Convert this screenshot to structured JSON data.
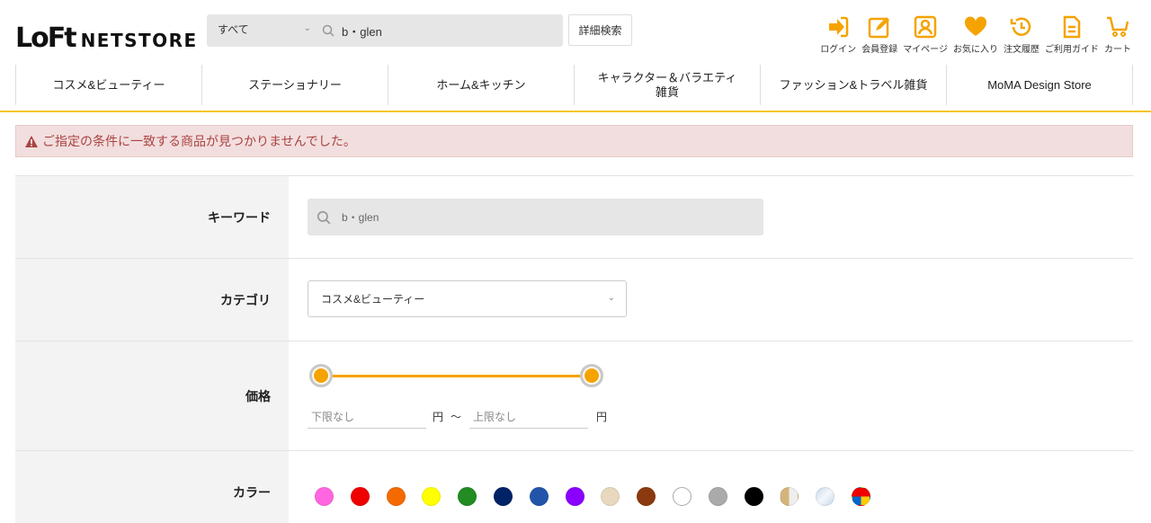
{
  "logo": {
    "mark": "LoFt",
    "text": "NETSTORE"
  },
  "search": {
    "category": "すべて",
    "value": "b・glen",
    "detail_label": "詳細検索"
  },
  "header_links": [
    {
      "label": "ログイン",
      "icon": "login-icon"
    },
    {
      "label": "会員登録",
      "icon": "register-icon"
    },
    {
      "label": "マイページ",
      "icon": "mypage-icon"
    },
    {
      "label": "お気に入り",
      "icon": "heart-icon"
    },
    {
      "label": "注文履歴",
      "icon": "history-icon"
    },
    {
      "label": "ご利用ガイド",
      "icon": "guide-icon"
    },
    {
      "label": "カート",
      "icon": "cart-icon"
    }
  ],
  "nav": [
    {
      "label": "コスメ&ビューティー"
    },
    {
      "label": "ステーショナリー"
    },
    {
      "label": "ホーム&キッチン"
    },
    {
      "label": "キャラクター＆バラエティ雑貨"
    },
    {
      "label": "ファッション&トラベル雑貨"
    },
    {
      "label": "MoMA Design Store"
    }
  ],
  "alert": {
    "message": "ご指定の条件に一致する商品が見つかりませんでした。"
  },
  "form": {
    "keyword": {
      "label": "キーワード",
      "value": "b・glen"
    },
    "category": {
      "label": "カテゴリ",
      "value": "コスメ&ビューティー"
    },
    "price": {
      "label": "価格",
      "min_placeholder": "下限なし",
      "max_placeholder": "上限なし",
      "unit": "円",
      "separator": "～"
    },
    "color": {
      "label": "カラー"
    }
  },
  "colors": {
    "accent": "#f5a300",
    "nav_line": "#f5c518",
    "alert_bg": "#f2dede",
    "alert_text": "#a94442",
    "swatches": [
      {
        "name": "pink",
        "color": "#ff66e0"
      },
      {
        "name": "red",
        "color": "#ee0000"
      },
      {
        "name": "orange",
        "color": "#f56a00"
      },
      {
        "name": "yellow",
        "color": "#ffff00"
      },
      {
        "name": "green",
        "color": "#228b22"
      },
      {
        "name": "navy",
        "color": "#002266"
      },
      {
        "name": "blue",
        "color": "#2255aa"
      },
      {
        "name": "purple",
        "color": "#8a00ff"
      },
      {
        "name": "beige",
        "color": "#e8d8be"
      },
      {
        "name": "brown",
        "color": "#8b3a0f"
      },
      {
        "name": "white",
        "color": "#ffffff"
      },
      {
        "name": "gray",
        "color": "#aaaaaa"
      },
      {
        "name": "black",
        "color": "#000000"
      },
      {
        "name": "gold",
        "color": "split-gold"
      },
      {
        "name": "silver",
        "color": "split-silver"
      },
      {
        "name": "multi",
        "color": "multi"
      }
    ]
  }
}
